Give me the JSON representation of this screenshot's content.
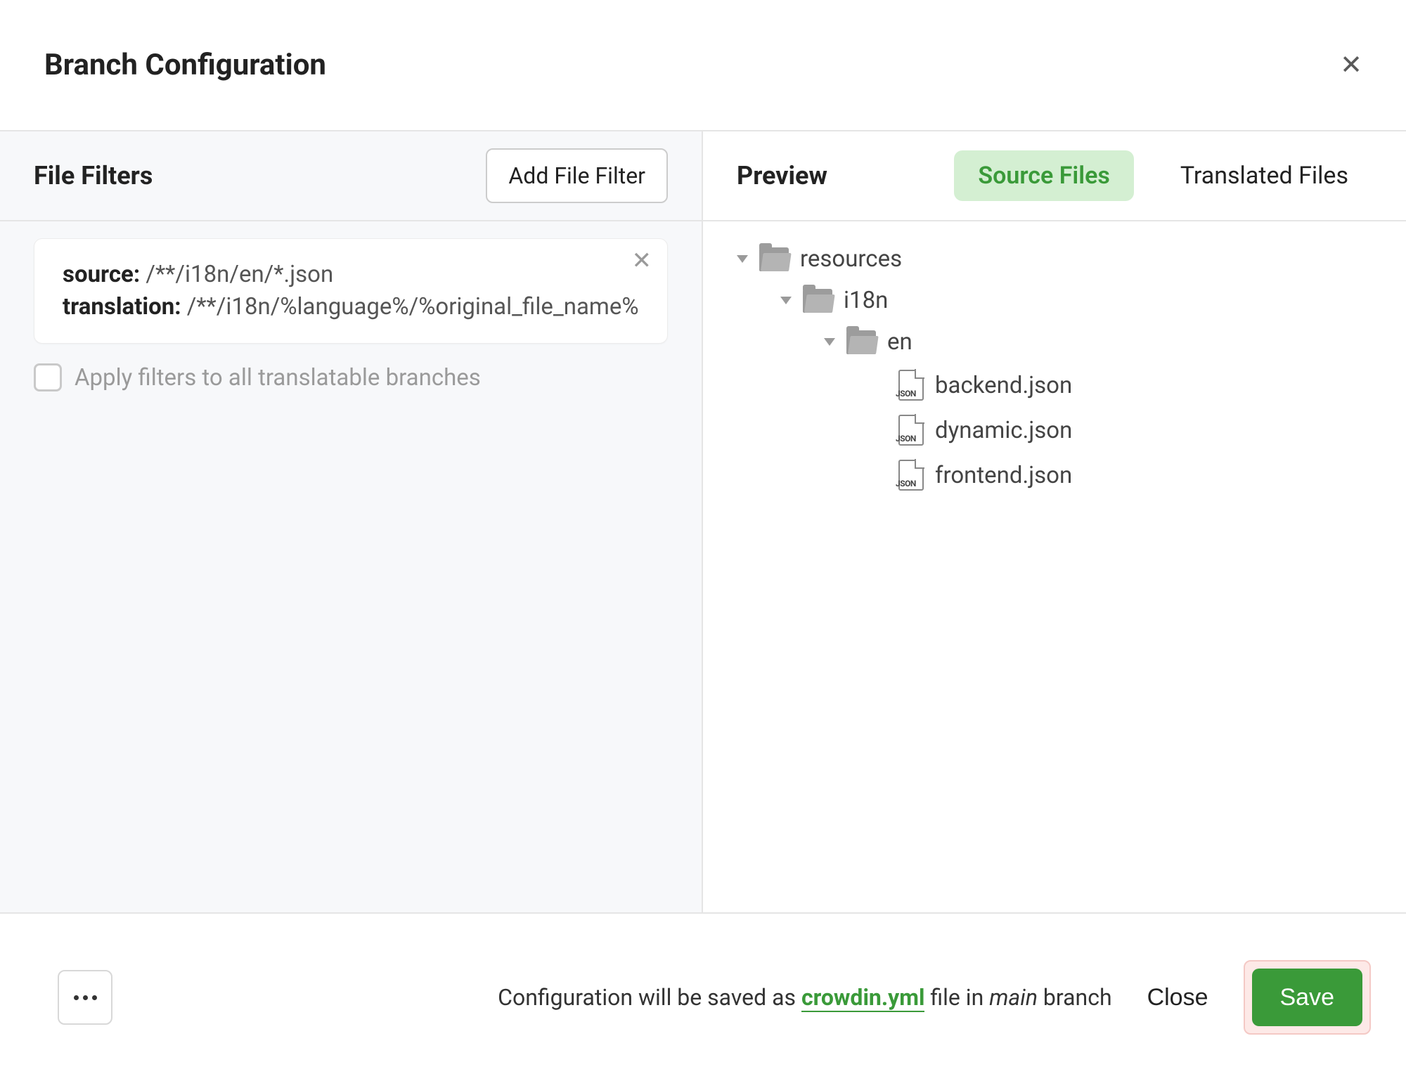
{
  "header": {
    "title": "Branch Configuration"
  },
  "left": {
    "title": "File Filters",
    "add_button": "Add File Filter",
    "filter": {
      "source_label": "source:",
      "source_value": "/**/i18n/en/*.json",
      "translation_label": "translation:",
      "translation_value": "/**/i18n/%language%/%original_file_name%"
    },
    "apply_checkbox": "Apply filters to all translatable branches"
  },
  "right": {
    "title": "Preview",
    "tabs": {
      "source": "Source Files",
      "translated": "Translated Files"
    },
    "tree": {
      "root": "resources",
      "level1": "i18n",
      "level2": "en",
      "files": [
        "backend.json",
        "dynamic.json",
        "frontend.json"
      ]
    }
  },
  "footer": {
    "msg_prefix": "Configuration will be saved as ",
    "config_file": "crowdin.yml",
    "msg_mid": " file in ",
    "branch_name": "main",
    "msg_suffix": " branch",
    "close": "Close",
    "save": "Save"
  },
  "json_icon_label": "JSON"
}
